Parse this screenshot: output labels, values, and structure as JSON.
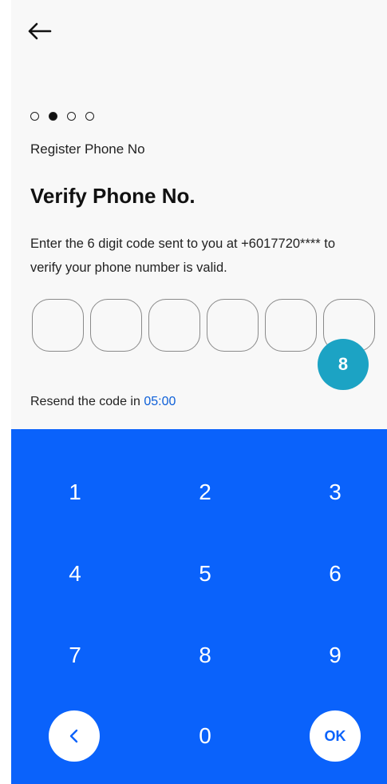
{
  "header": {
    "back_icon": "arrow-left-icon"
  },
  "progress": {
    "total_steps": 4,
    "current_step": 2,
    "step_label": "Register Phone No"
  },
  "main": {
    "title": "Verify Phone No.",
    "instructions_line1": "Enter the 6 digit code sent to you at +6017720**** to",
    "instructions_line2": "verify your phone number is valid.",
    "code_length": 6,
    "code_values": [
      "",
      "",
      "",
      "",
      "",
      ""
    ],
    "badge_value": "8",
    "resend_prefix": "Resend the code in",
    "resend_timer": "05:00"
  },
  "keypad": {
    "keys": [
      "1",
      "2",
      "3",
      "4",
      "5",
      "6",
      "7",
      "8",
      "9"
    ],
    "zero": "0",
    "back_icon": "chevron-left-icon",
    "ok_label": "OK"
  },
  "colors": {
    "keypad_bg": "#0a62fb",
    "timer": "#0d5fd8",
    "badge_bg": "#1ca3c4",
    "background": "#f8f8f8"
  }
}
